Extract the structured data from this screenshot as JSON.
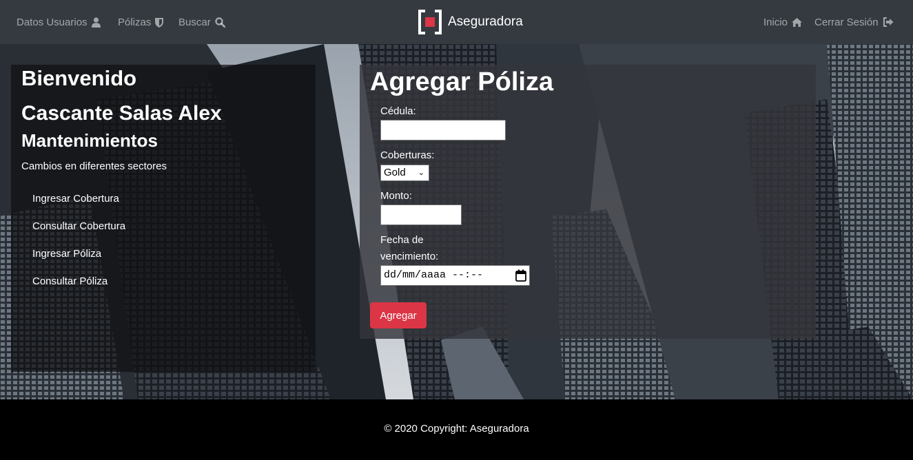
{
  "navbar": {
    "left_items": [
      {
        "label": "Datos Usuarios",
        "icon": "user-icon"
      },
      {
        "label": "Pólizas",
        "icon": "shield-icon"
      },
      {
        "label": "Buscar",
        "icon": "search-icon"
      }
    ],
    "brand": {
      "label": "Aseguradora",
      "icon": "brand-logo-icon",
      "accent": "#dc3545"
    },
    "right_items": [
      {
        "label": "Inicio",
        "icon": "home-icon"
      },
      {
        "label": "Cerrar Sesión",
        "icon": "sign-out-icon"
      }
    ]
  },
  "sidebar": {
    "welcome": "Bienvenido",
    "user_name": "Cascante Salas Alex",
    "section_title": "Mantenimientos",
    "description": "Cambios en diferentes sectores",
    "menu": [
      {
        "label": "Ingresar Cobertura"
      },
      {
        "label": "Consultar Cobertura"
      },
      {
        "label": "Ingresar Póliza"
      },
      {
        "label": "Consultar Póliza"
      }
    ]
  },
  "form": {
    "title": "Agregar Póliza",
    "cedula": {
      "label": "Cédula:",
      "value": ""
    },
    "coberturas": {
      "label": "Coberturas:",
      "selected": "Gold"
    },
    "monto": {
      "label": "Monto:",
      "value": ""
    },
    "fecha": {
      "label_line1": "Fecha de",
      "label_line2": "vencimiento:",
      "placeholder": "dd/mm/aaaa --:--"
    },
    "submit_label": "Agregar",
    "submit_color": "#dc3545"
  },
  "footer": {
    "text": "© 2020 Copyright: Aseguradora"
  }
}
